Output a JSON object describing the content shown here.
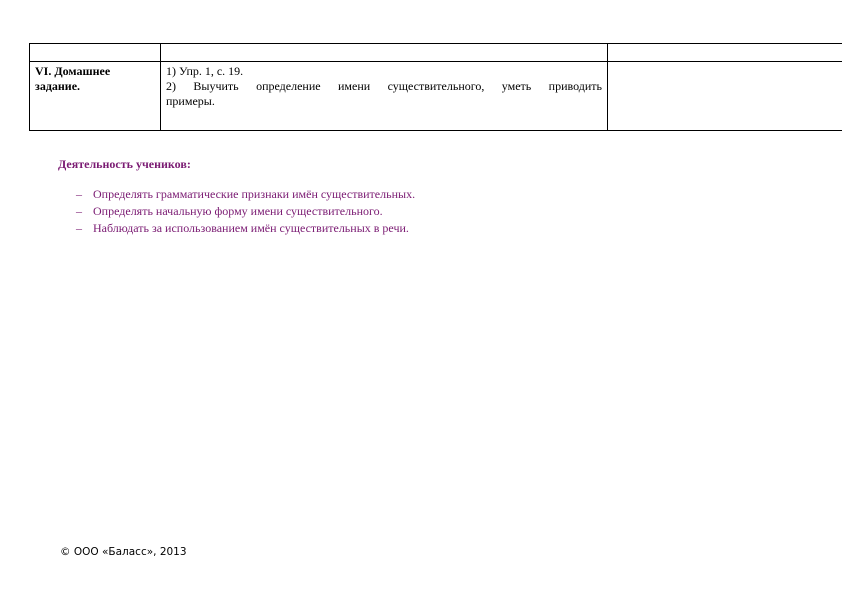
{
  "table": {
    "homework_stage": "VI. Домашнее задание.",
    "homework_tasks": [
      "1) Упр. 1, с. 19.",
      "2) Выучить определение имени существительного, уметь приводить",
      "примеры."
    ]
  },
  "activity": {
    "title": "Деятельность учеников:",
    "bullet": "–",
    "items": [
      "Определять грамматические признаки имён существительных.",
      "Определять начальную форму имени существительного.",
      "Наблюдать за использованием имён существительных в речи."
    ]
  },
  "footer": {
    "copyright": "© ООО «Баласс», 2013"
  },
  "colors": {
    "activity_text": "#7a1a72",
    "border": "#000000"
  }
}
